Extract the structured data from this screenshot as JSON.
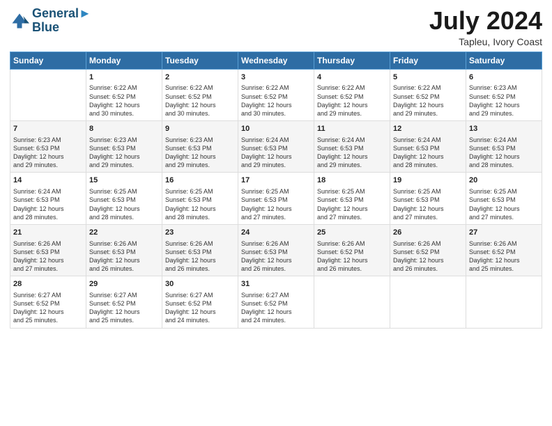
{
  "header": {
    "logo_line1": "General",
    "logo_line2": "Blue",
    "month_year": "July 2024",
    "location": "Tapleu, Ivory Coast"
  },
  "days_of_week": [
    "Sunday",
    "Monday",
    "Tuesday",
    "Wednesday",
    "Thursday",
    "Friday",
    "Saturday"
  ],
  "weeks": [
    [
      {
        "num": "",
        "info": ""
      },
      {
        "num": "1",
        "info": "Sunrise: 6:22 AM\nSunset: 6:52 PM\nDaylight: 12 hours\nand 30 minutes."
      },
      {
        "num": "2",
        "info": "Sunrise: 6:22 AM\nSunset: 6:52 PM\nDaylight: 12 hours\nand 30 minutes."
      },
      {
        "num": "3",
        "info": "Sunrise: 6:22 AM\nSunset: 6:52 PM\nDaylight: 12 hours\nand 30 minutes."
      },
      {
        "num": "4",
        "info": "Sunrise: 6:22 AM\nSunset: 6:52 PM\nDaylight: 12 hours\nand 29 minutes."
      },
      {
        "num": "5",
        "info": "Sunrise: 6:22 AM\nSunset: 6:52 PM\nDaylight: 12 hours\nand 29 minutes."
      },
      {
        "num": "6",
        "info": "Sunrise: 6:23 AM\nSunset: 6:52 PM\nDaylight: 12 hours\nand 29 minutes."
      }
    ],
    [
      {
        "num": "7",
        "info": "Sunrise: 6:23 AM\nSunset: 6:53 PM\nDaylight: 12 hours\nand 29 minutes."
      },
      {
        "num": "8",
        "info": "Sunrise: 6:23 AM\nSunset: 6:53 PM\nDaylight: 12 hours\nand 29 minutes."
      },
      {
        "num": "9",
        "info": "Sunrise: 6:23 AM\nSunset: 6:53 PM\nDaylight: 12 hours\nand 29 minutes."
      },
      {
        "num": "10",
        "info": "Sunrise: 6:24 AM\nSunset: 6:53 PM\nDaylight: 12 hours\nand 29 minutes."
      },
      {
        "num": "11",
        "info": "Sunrise: 6:24 AM\nSunset: 6:53 PM\nDaylight: 12 hours\nand 29 minutes."
      },
      {
        "num": "12",
        "info": "Sunrise: 6:24 AM\nSunset: 6:53 PM\nDaylight: 12 hours\nand 28 minutes."
      },
      {
        "num": "13",
        "info": "Sunrise: 6:24 AM\nSunset: 6:53 PM\nDaylight: 12 hours\nand 28 minutes."
      }
    ],
    [
      {
        "num": "14",
        "info": "Sunrise: 6:24 AM\nSunset: 6:53 PM\nDaylight: 12 hours\nand 28 minutes."
      },
      {
        "num": "15",
        "info": "Sunrise: 6:25 AM\nSunset: 6:53 PM\nDaylight: 12 hours\nand 28 minutes."
      },
      {
        "num": "16",
        "info": "Sunrise: 6:25 AM\nSunset: 6:53 PM\nDaylight: 12 hours\nand 28 minutes."
      },
      {
        "num": "17",
        "info": "Sunrise: 6:25 AM\nSunset: 6:53 PM\nDaylight: 12 hours\nand 27 minutes."
      },
      {
        "num": "18",
        "info": "Sunrise: 6:25 AM\nSunset: 6:53 PM\nDaylight: 12 hours\nand 27 minutes."
      },
      {
        "num": "19",
        "info": "Sunrise: 6:25 AM\nSunset: 6:53 PM\nDaylight: 12 hours\nand 27 minutes."
      },
      {
        "num": "20",
        "info": "Sunrise: 6:25 AM\nSunset: 6:53 PM\nDaylight: 12 hours\nand 27 minutes."
      }
    ],
    [
      {
        "num": "21",
        "info": "Sunrise: 6:26 AM\nSunset: 6:53 PM\nDaylight: 12 hours\nand 27 minutes."
      },
      {
        "num": "22",
        "info": "Sunrise: 6:26 AM\nSunset: 6:53 PM\nDaylight: 12 hours\nand 26 minutes."
      },
      {
        "num": "23",
        "info": "Sunrise: 6:26 AM\nSunset: 6:53 PM\nDaylight: 12 hours\nand 26 minutes."
      },
      {
        "num": "24",
        "info": "Sunrise: 6:26 AM\nSunset: 6:53 PM\nDaylight: 12 hours\nand 26 minutes."
      },
      {
        "num": "25",
        "info": "Sunrise: 6:26 AM\nSunset: 6:52 PM\nDaylight: 12 hours\nand 26 minutes."
      },
      {
        "num": "26",
        "info": "Sunrise: 6:26 AM\nSunset: 6:52 PM\nDaylight: 12 hours\nand 26 minutes."
      },
      {
        "num": "27",
        "info": "Sunrise: 6:26 AM\nSunset: 6:52 PM\nDaylight: 12 hours\nand 25 minutes."
      }
    ],
    [
      {
        "num": "28",
        "info": "Sunrise: 6:27 AM\nSunset: 6:52 PM\nDaylight: 12 hours\nand 25 minutes."
      },
      {
        "num": "29",
        "info": "Sunrise: 6:27 AM\nSunset: 6:52 PM\nDaylight: 12 hours\nand 25 minutes."
      },
      {
        "num": "30",
        "info": "Sunrise: 6:27 AM\nSunset: 6:52 PM\nDaylight: 12 hours\nand 24 minutes."
      },
      {
        "num": "31",
        "info": "Sunrise: 6:27 AM\nSunset: 6:52 PM\nDaylight: 12 hours\nand 24 minutes."
      },
      {
        "num": "",
        "info": ""
      },
      {
        "num": "",
        "info": ""
      },
      {
        "num": "",
        "info": ""
      }
    ]
  ]
}
